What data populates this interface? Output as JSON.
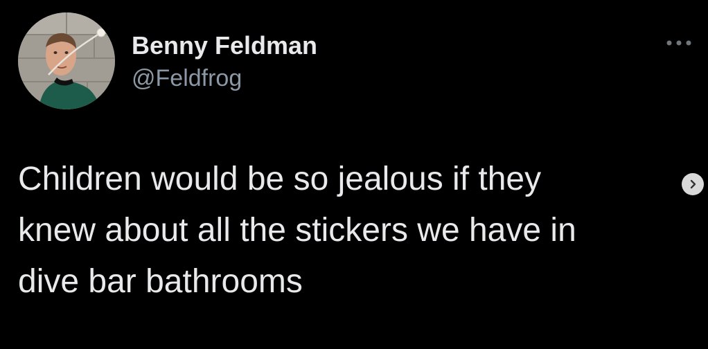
{
  "tweet": {
    "author": {
      "display_name": "Benny Feldman",
      "handle": "@Feldfrog"
    },
    "text": "Children would be so jealous if they\nknew about all the stickers we have in\ndive bar bathrooms",
    "more_icon": "more-horizontal-icon",
    "next_icon": "chevron-right-icon"
  },
  "colors": {
    "background": "#000000",
    "primary_text": "#e7e9ea",
    "secondary_text": "#8b98a5"
  }
}
